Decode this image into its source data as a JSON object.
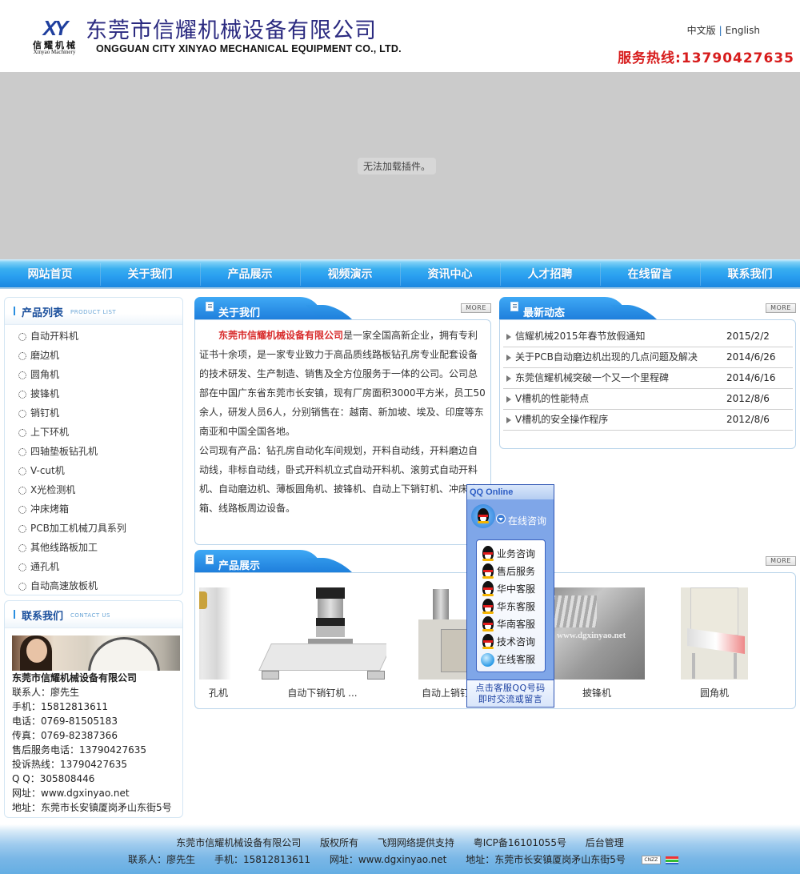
{
  "header": {
    "logo_mark": "XY",
    "logo_cn": "信耀机械",
    "logo_en": "Xinyao Machinery",
    "company_cn": "东莞市信耀机械设备有限公司",
    "company_en": "ONGGUAN CITY XINYAO MECHANICAL EQUIPMENT CO., LTD.",
    "lang_cn": "中文版",
    "lang_sep": "|",
    "lang_en": "English",
    "hotline_label": "服务热线:",
    "hotline_number": "13790427635"
  },
  "banner": {
    "plugin_message": "无法加载插件。"
  },
  "nav": {
    "items": [
      "网站首页",
      "关于我们",
      "产品展示",
      "视频演示",
      "资讯中心",
      "人才招聘",
      "在线留言",
      "联系我们"
    ]
  },
  "sidebar": {
    "products": {
      "title": "产品列表",
      "subtitle": "PRODUCT LIST",
      "items": [
        "自动开料机",
        "磨边机",
        "圆角机",
        "披锋机",
        "销钉机",
        "上下环机",
        "四轴垫板钻孔机",
        "V-cut机",
        "X光检测机",
        "冲床烤箱",
        "PCB加工机械刀具系列",
        "其他线路板加工",
        "通孔机",
        "自动高速放板机"
      ]
    },
    "contact": {
      "title": "联系我们",
      "subtitle": "CONTACT US",
      "company": "东莞市信耀机械设备有限公司",
      "lines": [
        "联系人：廖先生",
        "手机：15812813611",
        "电话：0769-81505183",
        "传真：0769-82387366",
        "售后服务电话：13790427635",
        "投诉热线：13790427635",
        "Q Q：305808446",
        "网址：www.dgxinyao.net",
        "地址：东莞市长安镇厦岗矛山东街5号"
      ]
    }
  },
  "about": {
    "title": "关于我们",
    "more": "MORE",
    "highlight": "东莞市信耀机械设备有限公司",
    "para1": "是一家全国高新企业，拥有专利证书十余项，是一家专业致力于高品质线路板钻孔房专业配套设备的技术研发、生产制造、销售及全方位服务于一体的公司。公司总部在中国广东省东莞市长安镇，现有厂房面积3000平方米，员工50余人，研发人员6人，分别销售在：越南、新加坡、埃及、印度等东南亚和中国全国各地。",
    "para2": "公司现有产品：钻孔房自动化车间规划，开料自动线，开料磨边自动线，非标自动线，卧式开料机立式自动开料机、滚剪式自动开料机、自动磨边机、薄板圆角机、披锋机、自动上下销钉机、冲床烤箱、线路板周边设备。"
  },
  "news": {
    "title": "最新动态",
    "more": "MORE",
    "items": [
      {
        "title": "信耀机械2015年春节放假通知",
        "date": "2015/2/2"
      },
      {
        "title": "关于PCB自动磨边机出现的几点问题及解决",
        "date": "2014/6/26"
      },
      {
        "title": "东莞信耀机械突破一个又一个里程碑",
        "date": "2014/6/16"
      },
      {
        "title": "V槽机的性能特点",
        "date": "2012/8/6"
      },
      {
        "title": "V槽机的安全操作程序",
        "date": "2012/8/6"
      }
    ]
  },
  "products_show": {
    "title": "产品展示",
    "more": "MORE",
    "items": [
      {
        "caption": "孔机"
      },
      {
        "caption": "自动下销钉机 ..."
      },
      {
        "caption": "自动上销钉机"
      },
      {
        "caption": "披锋机"
      },
      {
        "caption": "圆角机"
      }
    ],
    "watermark": "www.dgxinyao.net"
  },
  "qq_widget": {
    "header": "QQ Online",
    "main_label": "在线咨询",
    "items": [
      "业务咨询",
      "售后服务",
      "华中客服",
      "华东客服",
      "华南客服",
      "技术咨询"
    ],
    "online_service": "在线客服",
    "footer_line1": "点击客服QQ号码",
    "footer_line2": "即时交流或留言"
  },
  "footer": {
    "line1": [
      "东莞市信耀机械设备有限公司",
      "版权所有",
      "飞翔网络提供支持",
      "粤ICP备16101055号",
      "后台管理"
    ],
    "line2": [
      "联系人：廖先生",
      "手机：15812813611",
      "网址：www.dgxinyao.net",
      "地址：东莞市长安镇厦岗矛山东街5号"
    ],
    "cnzz": "CNZZ"
  }
}
